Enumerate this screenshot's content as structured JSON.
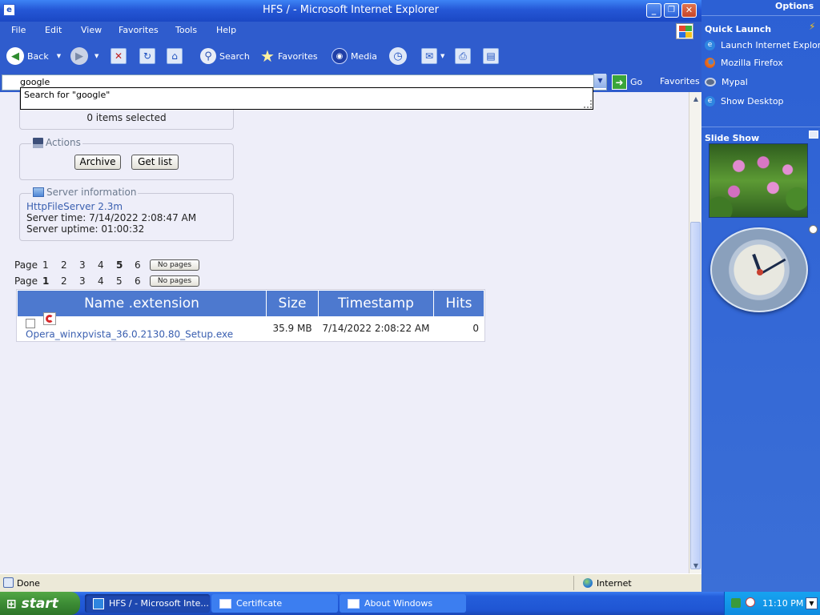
{
  "window": {
    "title": "HFS / - Microsoft Internet Explorer",
    "minimize": "_",
    "restore": "❐",
    "close": "✕"
  },
  "menu": [
    "File",
    "Edit",
    "View",
    "Favorites",
    "Tools",
    "Help"
  ],
  "toolbar": {
    "back": "Back",
    "search": "Search",
    "favorites": "Favorites",
    "media": "Media"
  },
  "address": {
    "value": "google",
    "suggestion": "Search for \"google\"",
    "go": "Go",
    "favorites_label": "Favorites"
  },
  "selection": {
    "text": "0 items selected"
  },
  "actions": {
    "legend": "Actions",
    "archive": "Archive",
    "get_list": "Get list"
  },
  "server": {
    "legend": "Server information",
    "name": "HttpFileServer 2.3m",
    "time": "Server time: 7/14/2022 2:08:47 AM",
    "uptime": "Server uptime: 01:00:32"
  },
  "pager1": {
    "label": "Page",
    "pages": [
      "1",
      "2",
      "3",
      "4",
      "5",
      "6"
    ],
    "current": 4,
    "nopages": "No pages"
  },
  "pager2": {
    "label": "Page",
    "pages": [
      "1",
      "2",
      "3",
      "4",
      "5",
      "6"
    ],
    "current": 0,
    "nopages": "No pages"
  },
  "table": {
    "headers": [
      "Name .extension",
      "Size",
      "Timestamp",
      "Hits"
    ],
    "rows": [
      {
        "name": "Opera_winxpvista_36.0.2130.80_Setup.exe",
        "size": "35.9 MB",
        "timestamp": "7/14/2022 2:08:22 AM",
        "hits": "0"
      }
    ]
  },
  "status": {
    "left": "Done",
    "zone": "Internet"
  },
  "rightpane": {
    "options": "Options",
    "quick_launch": "Quick Launch",
    "items": [
      "Launch Internet Explorer",
      "Mozilla Firefox",
      "Mypal",
      "Show Desktop"
    ],
    "slideshow": "Slide Show"
  },
  "taskbar": {
    "start": "start",
    "tasks": [
      "HFS / - Microsoft Inte...",
      "Certificate",
      "About Windows"
    ],
    "clock": "11:10 PM"
  },
  "colors": {
    "accent": "#4d79cf",
    "link": "#3a5fb0",
    "titlebar": "#2557d6",
    "start": "#3c8c35"
  }
}
